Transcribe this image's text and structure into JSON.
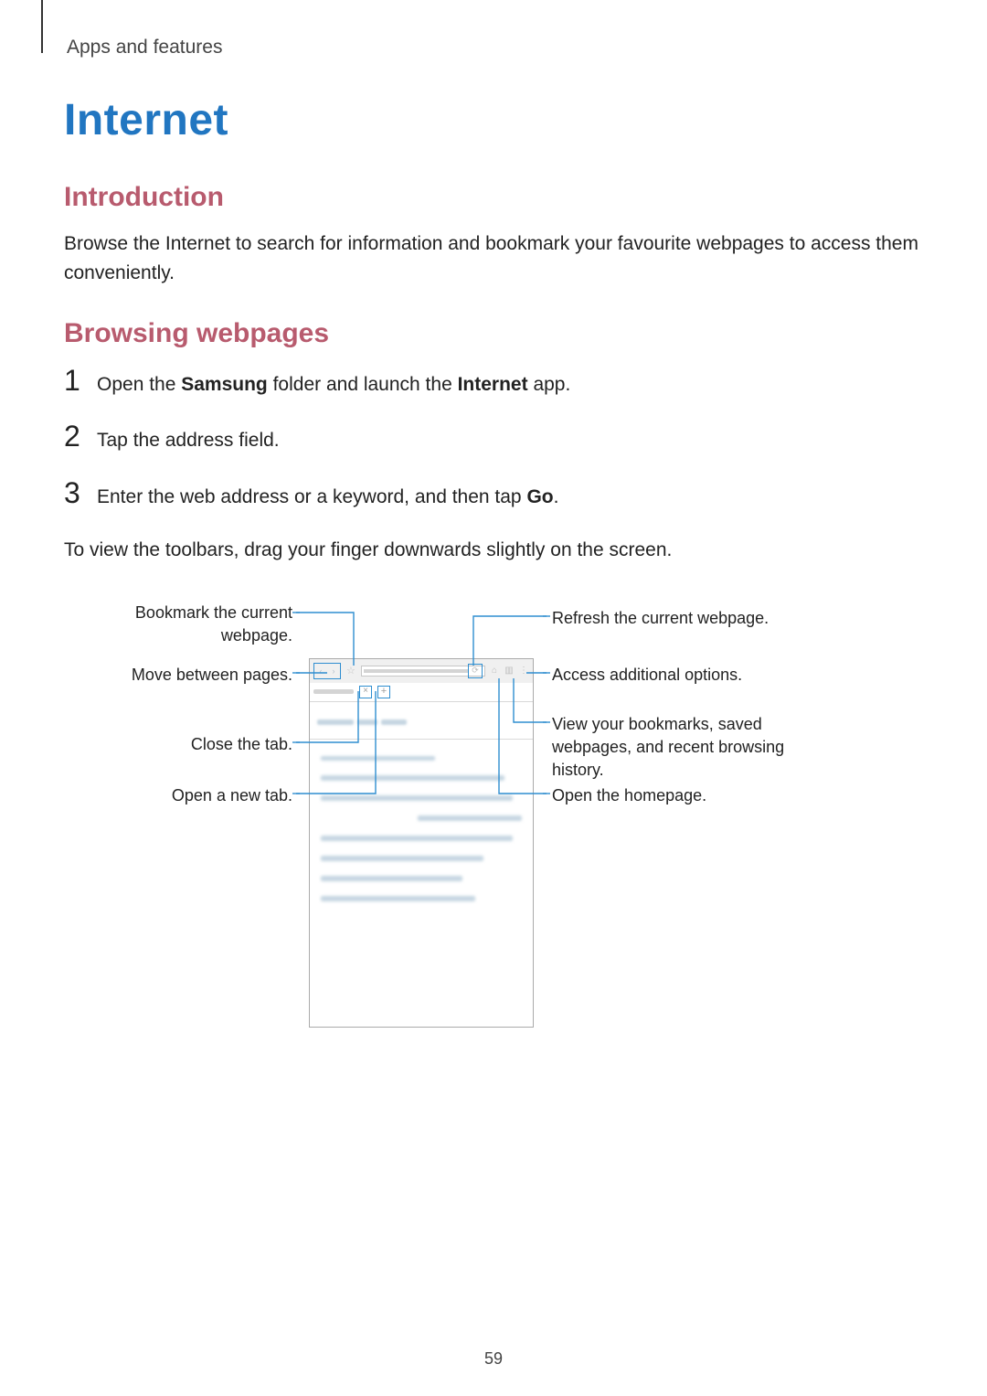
{
  "header": {
    "section": "Apps and features"
  },
  "title": "Internet",
  "intro": {
    "heading": "Introduction",
    "text": "Browse the Internet to search for information and bookmark your favourite webpages to access them conveniently."
  },
  "browsing": {
    "heading": "Browsing webpages",
    "steps": [
      {
        "num": "1",
        "pre": "Open the ",
        "bold1": "Samsung",
        "mid": " folder and launch the ",
        "bold2": "Internet",
        "post": " app."
      },
      {
        "num": "2",
        "pre": "Tap the address field.",
        "bold1": "",
        "mid": "",
        "bold2": "",
        "post": ""
      },
      {
        "num": "3",
        "pre": "Enter the web address or a keyword, and then tap ",
        "bold1": "Go",
        "mid": ".",
        "bold2": "",
        "post": ""
      }
    ],
    "note": "To view the toolbars, drag your finger downwards slightly on the screen."
  },
  "callouts": {
    "left": {
      "bookmark": "Bookmark the current webpage.",
      "move": "Move between pages.",
      "close": "Close the tab.",
      "newtab": "Open a new tab."
    },
    "right": {
      "refresh": "Refresh the current webpage.",
      "options": "Access additional options.",
      "bookmarks": "View your bookmarks, saved webpages, and recent browsing history.",
      "home": "Open the homepage."
    }
  },
  "pageNumber": "59"
}
